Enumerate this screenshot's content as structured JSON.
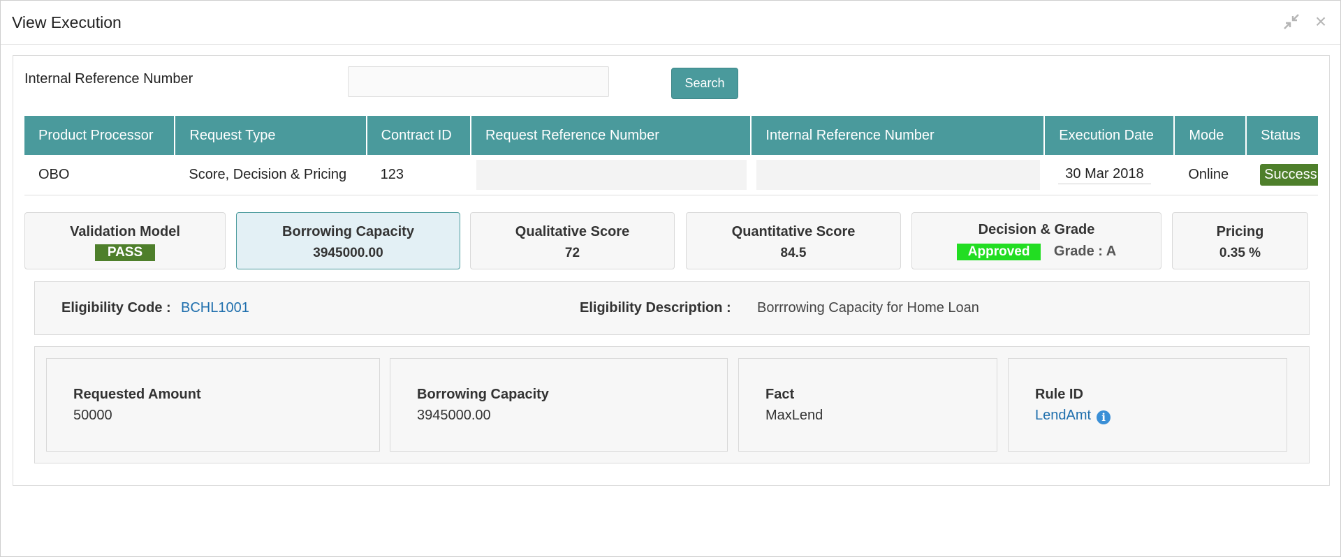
{
  "window": {
    "title": "View Execution",
    "minimize_icon": "collapse-arrows-icon",
    "close_icon": "close-icon",
    "close_glyph": "×"
  },
  "search": {
    "label": "Internal Reference Number",
    "value": "",
    "placeholder": "",
    "button_label": "Search"
  },
  "table": {
    "columns": [
      "Product Processor",
      "Request Type",
      "Contract ID",
      "Request Reference Number",
      "Internal Reference Number",
      "Execution Date",
      "Mode",
      "Status"
    ],
    "row": {
      "product_processor": "OBO",
      "request_type": "Score, Decision & Pricing",
      "contract_id": "123",
      "request_reference_number": "",
      "internal_reference_number": "",
      "execution_date": "30 Mar 2018",
      "mode": "Online",
      "status": "Success"
    },
    "status_color": "#4e7f2b"
  },
  "summary_cards": {
    "validation": {
      "title": "Validation Model",
      "value": "PASS"
    },
    "borrowing": {
      "title": "Borrowing Capacity",
      "value": "3945000.00"
    },
    "qualitative": {
      "title": "Qualitative Score",
      "value": "72"
    },
    "quantitative": {
      "title": "Quantitative Score",
      "value": "84.5"
    },
    "decision": {
      "title": "Decision & Grade",
      "decision": "Approved",
      "grade": "Grade : A"
    },
    "pricing": {
      "title": "Pricing",
      "value": "0.35 %"
    }
  },
  "eligibility": {
    "code_label": "Eligibility Code :",
    "code_value": "BCHL1001",
    "description_label": "Eligibility Description :",
    "description_value": "Borrrowing Capacity for Home Loan"
  },
  "details": {
    "requested_amount": {
      "label": "Requested Amount",
      "value": "50000"
    },
    "borrowing_capacity": {
      "label": "Borrowing Capacity",
      "value": "3945000.00"
    },
    "fact": {
      "label": "Fact",
      "value": "MaxLend"
    },
    "rule_id": {
      "label": "Rule ID",
      "value": "LendAmt",
      "icon": "info-icon"
    }
  },
  "colors": {
    "header_teal": "#4a9a9c",
    "pass_green": "#4e7f2b",
    "approved_green": "#22dd22",
    "link_blue": "#1f6fad",
    "selected_card_bg": "#e3f0f5"
  }
}
